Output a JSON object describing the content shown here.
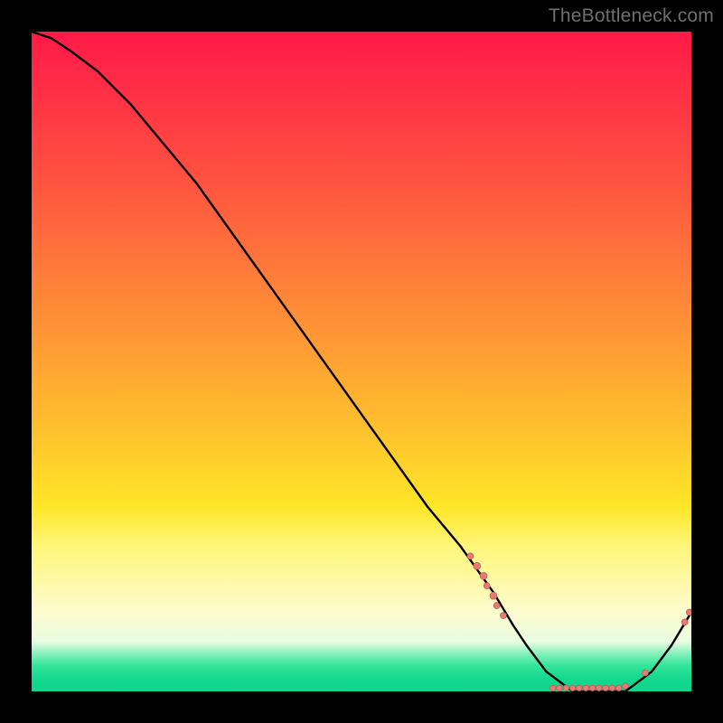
{
  "watermark": "TheBottleneck.com",
  "colors": {
    "page_bg": "#000000",
    "watermark": "#6f6f6f",
    "curve": "#000000",
    "dot_fill": "#e77a73",
    "dot_stroke": "#b94f49",
    "gradient_stops": [
      "#ff1a47",
      "#ff2d46",
      "#ff5140",
      "#ff7a3a",
      "#ffa233",
      "#ffc62d",
      "#ffe628",
      "#fff67a",
      "#fdfccf",
      "#e8fce0",
      "#94f2c2",
      "#35e69a",
      "#14d98f",
      "#0fd68e"
    ]
  },
  "chart_data": {
    "type": "line",
    "title": "",
    "xlabel": "",
    "ylabel": "",
    "xlim": [
      0,
      100
    ],
    "ylim": [
      0,
      100
    ],
    "grid": false,
    "legend": false,
    "series": [
      {
        "name": "bottleneck-curve",
        "x": [
          0,
          3,
          6,
          10,
          15,
          20,
          25,
          30,
          35,
          40,
          45,
          50,
          55,
          60,
          65,
          70,
          73,
          75,
          78,
          82,
          86,
          90,
          94,
          97,
          100
        ],
        "values": [
          100,
          99,
          97,
          94,
          89,
          83,
          77,
          70,
          63,
          56,
          49,
          42,
          35,
          28,
          22,
          15,
          10,
          7,
          3,
          0,
          0,
          0,
          3,
          7,
          12
        ]
      }
    ],
    "scatter_overlay": {
      "name": "highlight-points",
      "points": [
        {
          "x": 66.5,
          "y": 20.5,
          "r": 3.5
        },
        {
          "x": 67.5,
          "y": 19.0,
          "r": 4.0
        },
        {
          "x": 68.5,
          "y": 17.5,
          "r": 4.0
        },
        {
          "x": 69.0,
          "y": 16.0,
          "r": 3.5
        },
        {
          "x": 70.0,
          "y": 14.5,
          "r": 4.0
        },
        {
          "x": 70.5,
          "y": 13.0,
          "r": 3.5
        },
        {
          "x": 71.5,
          "y": 11.5,
          "r": 3.5
        },
        {
          "x": 79.0,
          "y": 0.5,
          "r": 3.3
        },
        {
          "x": 80.0,
          "y": 0.5,
          "r": 3.3
        },
        {
          "x": 81.0,
          "y": 0.5,
          "r": 3.3
        },
        {
          "x": 82.0,
          "y": 0.5,
          "r": 3.3
        },
        {
          "x": 83.0,
          "y": 0.5,
          "r": 3.3
        },
        {
          "x": 84.0,
          "y": 0.5,
          "r": 3.3
        },
        {
          "x": 85.0,
          "y": 0.5,
          "r": 3.3
        },
        {
          "x": 86.0,
          "y": 0.5,
          "r": 3.3
        },
        {
          "x": 87.0,
          "y": 0.5,
          "r": 3.3
        },
        {
          "x": 88.0,
          "y": 0.5,
          "r": 3.3
        },
        {
          "x": 89.0,
          "y": 0.5,
          "r": 3.3
        },
        {
          "x": 90.0,
          "y": 0.8,
          "r": 3.3
        },
        {
          "x": 93.0,
          "y": 2.8,
          "r": 3.5
        },
        {
          "x": 99.0,
          "y": 10.5,
          "r": 3.5
        },
        {
          "x": 99.7,
          "y": 12.0,
          "r": 3.5
        }
      ]
    }
  }
}
